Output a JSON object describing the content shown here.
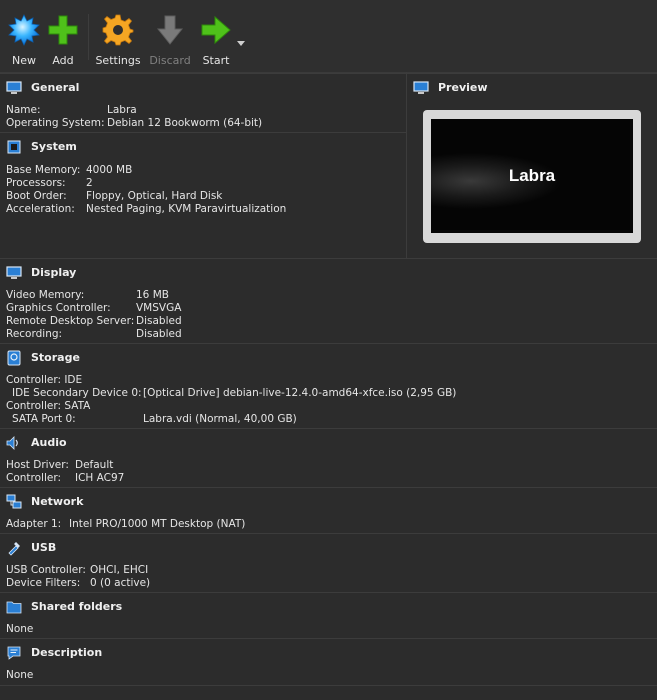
{
  "toolbar": {
    "new_label": "New",
    "add_label": "Add",
    "settings_label": "Settings",
    "discard_label": "Discard",
    "start_label": "Start"
  },
  "general": {
    "title": "General",
    "rows": [
      {
        "k": "Name:",
        "v": "Labra"
      },
      {
        "k": "Operating System:",
        "v": "Debian 12 Bookworm (64-bit)"
      }
    ]
  },
  "preview": {
    "title": "Preview",
    "vm_name": "Labra"
  },
  "system": {
    "title": "System",
    "rows": [
      {
        "k": "Base Memory:",
        "v": "4000 MB"
      },
      {
        "k": "Processors:",
        "v": "2"
      },
      {
        "k": "Boot Order:",
        "v": "Floppy, Optical, Hard Disk"
      },
      {
        "k": "Acceleration:",
        "v": "Nested Paging, KVM Paravirtualization"
      }
    ]
  },
  "display": {
    "title": "Display",
    "rows": [
      {
        "k": "Video Memory:",
        "v": "16 MB"
      },
      {
        "k": "Graphics Controller:",
        "v": "VMSVGA"
      },
      {
        "k": "Remote Desktop Server:",
        "v": "Disabled"
      },
      {
        "k": "Recording:",
        "v": "Disabled"
      }
    ]
  },
  "storage": {
    "title": "Storage",
    "rows": [
      {
        "k": "Controller: IDE",
        "v": ""
      },
      {
        "k": "IDE Secondary Device 0:",
        "v": "[Optical Drive] debian-live-12.4.0-amd64-xfce.iso (2,95 GB)"
      },
      {
        "k": "Controller: SATA",
        "v": ""
      },
      {
        "k": "SATA Port 0:",
        "v": "Labra.vdi (Normal, 40,00 GB)"
      }
    ]
  },
  "audio": {
    "title": "Audio",
    "rows": [
      {
        "k": "Host Driver:",
        "v": "Default"
      },
      {
        "k": "Controller:",
        "v": "ICH AC97"
      }
    ]
  },
  "network": {
    "title": "Network",
    "rows": [
      {
        "k": "Adapter 1:",
        "v": "Intel PRO/1000 MT Desktop (NAT)"
      }
    ]
  },
  "usb": {
    "title": "USB",
    "rows": [
      {
        "k": "USB Controller:",
        "v": "OHCI, EHCI"
      },
      {
        "k": "Device Filters:",
        "v": "0 (0 active)"
      }
    ]
  },
  "shared_folders": {
    "title": "Shared folders",
    "value": "None"
  },
  "description": {
    "title": "Description",
    "value": "None"
  }
}
